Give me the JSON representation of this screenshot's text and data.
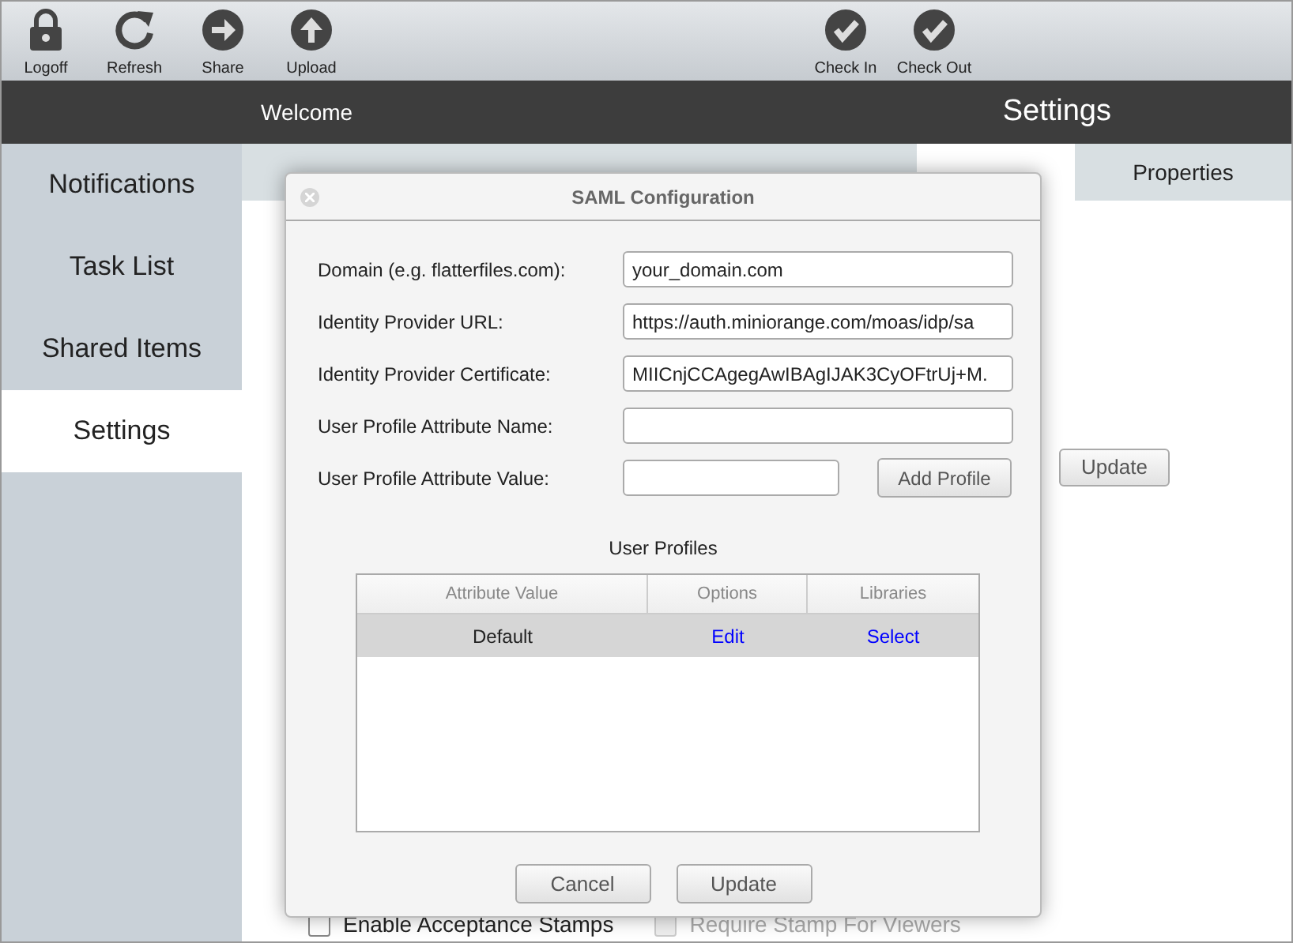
{
  "toolbar": {
    "left": [
      {
        "kind": "lock",
        "label": "Logoff"
      },
      {
        "kind": "refresh",
        "label": "Refresh"
      },
      {
        "kind": "share",
        "label": "Share"
      },
      {
        "kind": "upload",
        "label": "Upload"
      }
    ],
    "right": [
      {
        "kind": "check",
        "label": "Check In"
      },
      {
        "kind": "check",
        "label": "Check Out"
      }
    ]
  },
  "header": {
    "welcome": "Welcome",
    "title": "Settings"
  },
  "sidebar": {
    "items": [
      {
        "label": "Notifications",
        "selected": false
      },
      {
        "label": "Task List",
        "selected": false
      },
      {
        "label": "Shared Items",
        "selected": false
      },
      {
        "label": "Settings",
        "selected": true
      }
    ]
  },
  "tabs": [
    {
      "label": "Properties",
      "selected": false
    }
  ],
  "page": {
    "update_button": "Update",
    "checkboxes": [
      {
        "label": "Enable Acceptance Stamps",
        "disabled": false
      },
      {
        "label": "Require Stamp For Viewers",
        "disabled": true
      }
    ]
  },
  "dialog": {
    "title": "SAML Configuration",
    "fields": [
      {
        "label": "Domain (e.g. flatterfiles.com):",
        "value": "your_domain.com"
      },
      {
        "label": "Identity Provider URL:",
        "value": "https://auth.miniorange.com/moas/idp/sa"
      },
      {
        "label": "Identity Provider Certificate:",
        "value": "MIICnjCCAgegAwIBAgIJAK3CyOFtrUj+M."
      },
      {
        "label": "User Profile Attribute Name:"
      },
      {
        "label": "User Profile Attribute Value:",
        "button": "Add Profile"
      }
    ],
    "profiles_title": "User Profiles",
    "table": {
      "columns": [
        "Attribute Value",
        "Options",
        "Libraries"
      ],
      "rows": [
        {
          "value": "Default",
          "edit": "Edit",
          "select": "Select",
          "selected": true
        }
      ]
    },
    "buttons": [
      "Cancel",
      "Update"
    ]
  }
}
